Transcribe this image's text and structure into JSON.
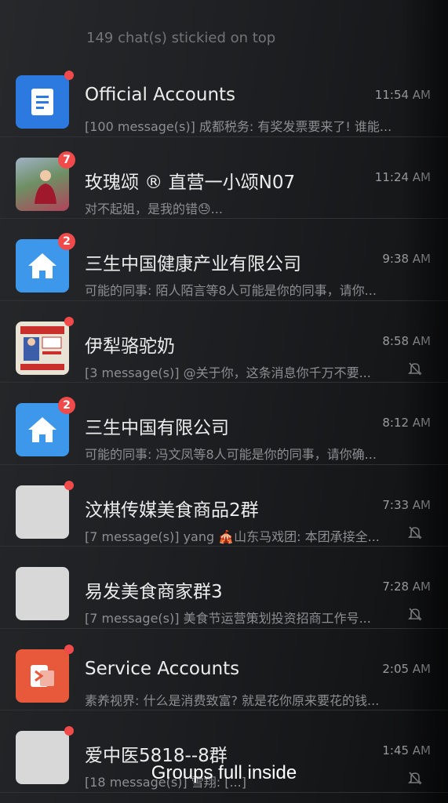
{
  "sticky_note": "149 chat(s) stickied on top",
  "chats": [
    {
      "title": "Official Accounts",
      "preview": "[100 message(s)] 成都税务: 有奖发票要来了! 谁能...",
      "time": "11:54 AM",
      "badge": "",
      "muted": false,
      "avatar_icon": "document-icon",
      "avatar_color": "#2c79e0"
    },
    {
      "title": "玫瑰颂 ® 直营一小颂N07",
      "preview": "对不起姐，是我的错😓...",
      "time": "11:24 AM",
      "badge": "7",
      "muted": false,
      "avatar_icon": "photo-avatar"
    },
    {
      "title": "三生中国健康产业有限公司",
      "preview": "可能的同事: 陌人陌言等8人可能是你的同事，请你...",
      "time": "9:38 AM",
      "badge": "2",
      "muted": false,
      "avatar_icon": "home-icon",
      "avatar_color": "#3d97ea"
    },
    {
      "title": "伊犁骆驼奶",
      "preview": "[3 message(s)] @关于你，这条消息你千万不要...",
      "time": "8:58 AM",
      "badge": "",
      "muted": true,
      "avatar_icon": "promo-avatar"
    },
    {
      "title": "三生中国有限公司",
      "preview": "可能的同事: 冯文凤等8人可能是你的同事，请你确...",
      "time": "8:12 AM",
      "badge": "2",
      "muted": false,
      "avatar_icon": "home-icon",
      "avatar_color": "#3d97ea"
    },
    {
      "title": "汶棋传媒美食商品2群",
      "preview": "[7 message(s)] yang 🎪山东马戏团: 本团承接全...",
      "time": "7:33 AM",
      "badge": "",
      "muted": true,
      "avatar_icon": "group-grid-avatar"
    },
    {
      "title": "易发美食商家群3",
      "preview": "[7 message(s)] 美食节运营策划投资招商工作号...",
      "time": "7:28 AM",
      "badge": "",
      "muted": true,
      "avatar_icon": "group-grid-avatar"
    },
    {
      "title": "Service Accounts",
      "preview": "素养视界: 什么是消费致富? 就是花你原来要花的钱...",
      "time": "2:05 AM",
      "badge": "",
      "muted": false,
      "avatar_icon": "service-icon",
      "avatar_color": "#e8583a"
    },
    {
      "title": "爱中医5818--8群",
      "preview": "[18 message(s)] 雪翔: [...]",
      "time": "1:45 AM",
      "badge": "",
      "muted": true,
      "avatar_icon": "group-grid-avatar"
    }
  ],
  "caption": "Groups full inside",
  "colors": {
    "badge": "#f04a4a",
    "background": "#1e2023",
    "title_text": "#ececec",
    "preview_text": "#8c8e92"
  }
}
